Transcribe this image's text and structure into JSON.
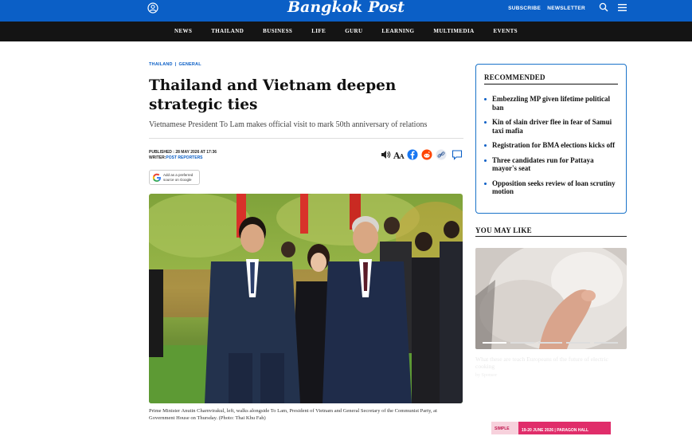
{
  "header": {
    "logo": "Bangkok Post",
    "subscribe": "SUBSCRIBE",
    "newsletter": "NEWSLETTER"
  },
  "nav": [
    "NEWS",
    "THAILAND",
    "BUSINESS",
    "LIFE",
    "GURU",
    "LEARNING",
    "MULTIMEDIA",
    "EVENTS"
  ],
  "article": {
    "breadcrumb": [
      "THAILAND",
      "GENERAL"
    ],
    "breadcrumb_sep": "|",
    "headline": "Thailand and Vietnam deepen strategic ties",
    "subhead": "Vietnamese President To Lam makes official visit to mark 50th anniversary of relations",
    "published": "PUBLISHED : 28 MAY 2026 AT 17:36",
    "writer_label": "WRITER:",
    "writer": "POST REPORTERS",
    "google_badge": [
      "Add as a preferred",
      "source on Google"
    ],
    "caption": "Prime Minister Anutin Charnvirakul, left, walks alongside To Lam, President of Vietnam and General Secretary of the Communist Party, at Government House on Thursday. (Photo: Thai Khu Fah)"
  },
  "recommended": {
    "title": "RECOMMENDED",
    "items": [
      "Embezzling MP given lifetime political ban",
      "Kin of slain driver flee in fear of Samui taxi mafia",
      "Registration for BMA elections kicks off",
      "Three candidates run for Pattaya mayor's seat",
      "Opposition seeks review of loan scrutiny motion"
    ]
  },
  "you_may_like": {
    "title": "YOU MAY LIKE",
    "sponsored_text": "What these are teach Europeans of the future of electric cooking",
    "sponsored_source": "by Sponsor"
  },
  "ad": {
    "brand": "SIMPLE",
    "text": "19-20 JUNE 2026 | PARAGON HALL"
  },
  "colors": {
    "brand_blue": "#0b5fc6",
    "nav_black": "#141414"
  }
}
